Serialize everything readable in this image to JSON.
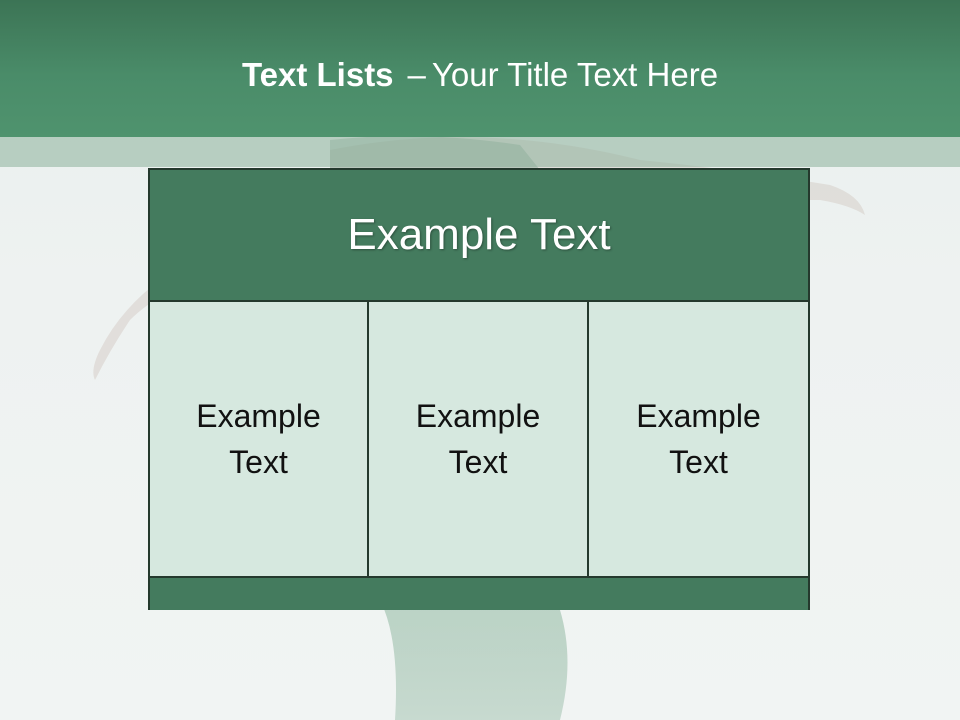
{
  "slide": {
    "title_bold": "Text Lists",
    "title_separator": "–",
    "title_rest": "Your Title Text Here"
  },
  "table": {
    "header": "Example Text",
    "cells": [
      {
        "line1": "Example",
        "line2": "Text"
      },
      {
        "line1": "Example",
        "line2": "Text"
      },
      {
        "line1": "Example",
        "line2": "Text"
      }
    ]
  },
  "colors": {
    "header_green": "#4a8c69",
    "table_head_green": "#447b5e",
    "cell_mint": "#d6e8df",
    "border_dark": "#24392d",
    "background": "#eef2f1"
  }
}
